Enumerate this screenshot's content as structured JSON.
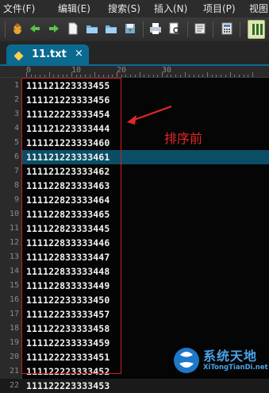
{
  "menu": [
    "文件(F)",
    "编辑(E)",
    "搜索(S)",
    "插入(N)",
    "项目(P)",
    "视图"
  ],
  "toolbar_icons": [
    "bug-icon",
    "back-arrow-icon",
    "forward-arrow-icon",
    "new-file-icon",
    "open-folder-icon",
    "open-folder-icon",
    "save-icon",
    "print-icon",
    "print-preview-icon",
    "wrap-icon",
    "calculator-icon",
    "column-icon"
  ],
  "tab": {
    "label": "11.txt",
    "close": "×"
  },
  "ruler": [
    "0",
    "10",
    "20",
    "30"
  ],
  "line_numbers": [
    "1",
    "2",
    "3",
    "4",
    "5",
    "6",
    "7",
    "8",
    "9",
    "10",
    "11",
    "12",
    "13",
    "14",
    "15",
    "16",
    "17",
    "18",
    "19",
    "20",
    "21",
    "22"
  ],
  "lines": [
    "111121223333455",
    "111121223333456",
    "111122223333454",
    "111121223333444",
    "111121223333460",
    "111121223333461",
    "111121223333462",
    "111122823333463",
    "111122823333464",
    "111122823333465",
    "111122823333445",
    "111122833333446",
    "111122833333447",
    "111122833333448",
    "111122833333449",
    "111122233333450",
    "111122233333457",
    "111122233333458",
    "111122233333459",
    "111122223333451",
    "111122223333452",
    "111122223333453"
  ],
  "highlighted_line": 6,
  "annotation": "排序前",
  "watermark": {
    "title": "系统天地",
    "subtitle": "XiTongTianDi.net"
  },
  "colors": {
    "accent": "#0b6a90",
    "annotation": "#e3262a",
    "highlight": "#0a4e66"
  }
}
